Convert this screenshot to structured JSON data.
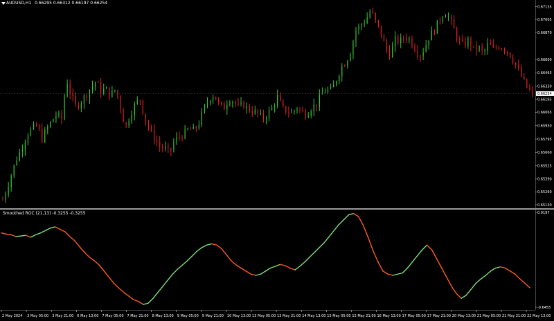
{
  "symbol_header": {
    "symbol": "AUDUSD,H1",
    "ohlc": "0.66295 0.66312 0.66197 0.66254"
  },
  "price_scale": {
    "ticks": [
      "0.67135",
      "0.67005",
      "0.66870",
      "0.66600",
      "0.66465",
      "0.66330",
      "0.66195",
      "0.66065",
      "0.65930",
      "0.65795",
      "0.65660",
      "0.65525",
      "0.65390",
      "0.65260",
      "0.65130"
    ],
    "current_price": "0.66254"
  },
  "indicator": {
    "title": "Smoothed ROC (21,13) -0.3255 -0.3255",
    "scale_top": "0.9197",
    "scale_bottom": "-0.6455"
  },
  "time_axis": {
    "labels": [
      "2 May 2024",
      "3 May 05:00",
      "3 May 21:00",
      "6 May 13:00",
      "7 May 05:00",
      "7 May 21:00",
      "8 May 13:00",
      "9 May 05:00",
      "9 May 21:00",
      "10 May 13:00",
      "13 May 05:00",
      "13 May 21:00",
      "14 May 13:00",
      "15 May 05:00",
      "15 May 21:00",
      "16 May 13:00",
      "17 May 05:00",
      "17 May 21:00",
      "20 May 13:00",
      "21 May 05:00",
      "21 May 21:00",
      "22 May 13:00"
    ]
  },
  "colors": {
    "background": "#000000",
    "bull_candle": "#32c832",
    "bear_candle": "#e02020",
    "roc_up": "#7ee07e",
    "roc_down": "#ff5a1f",
    "separator": "#9a9a9a"
  },
  "chart_data": [
    {
      "type": "candlestick",
      "title": "AUDUSD,H1",
      "ylim": [
        0.6513,
        0.6716
      ],
      "close_path": [
        0.6518,
        0.6532,
        0.6548,
        0.6562,
        0.6572,
        0.6585,
        0.659,
        0.6593,
        0.658,
        0.659,
        0.6598,
        0.6605,
        0.66,
        0.664,
        0.6622,
        0.6612,
        0.6618,
        0.6624,
        0.6632,
        0.6638,
        0.6628,
        0.663,
        0.6624,
        0.663,
        0.6612,
        0.659,
        0.6605,
        0.6615,
        0.662,
        0.66,
        0.6588,
        0.658,
        0.6572,
        0.657,
        0.6565,
        0.6578,
        0.6582,
        0.6585,
        0.659,
        0.6588,
        0.6596,
        0.661,
        0.662,
        0.6625,
        0.6615,
        0.661,
        0.662,
        0.6618,
        0.6612,
        0.6615,
        0.661,
        0.6608,
        0.6605,
        0.66,
        0.6605,
        0.6612,
        0.6622,
        0.661,
        0.6608,
        0.6606,
        0.6612,
        0.6606,
        0.6605,
        0.6612,
        0.6615,
        0.6625,
        0.663,
        0.6628,
        0.664,
        0.6652,
        0.6658,
        0.667,
        0.669,
        0.6695,
        0.67,
        0.671,
        0.6698,
        0.6688,
        0.6672,
        0.6665,
        0.668,
        0.6678,
        0.6684,
        0.668,
        0.6672,
        0.6664,
        0.6672,
        0.6684,
        0.669,
        0.67,
        0.6708,
        0.6702,
        0.669,
        0.6678,
        0.6674,
        0.668,
        0.667,
        0.6672,
        0.6666,
        0.6676,
        0.667,
        0.6674,
        0.6672,
        0.6668,
        0.666,
        0.665,
        0.664,
        0.663,
        0.6625
      ]
    },
    {
      "type": "line",
      "title": "Smoothed ROC (21,13)",
      "ylim": [
        -0.6455,
        0.9197
      ],
      "values": [
        0.58,
        0.56,
        0.55,
        0.52,
        0.53,
        0.54,
        0.51,
        0.55,
        0.58,
        0.62,
        0.66,
        0.68,
        0.64,
        0.6,
        0.52,
        0.45,
        0.35,
        0.26,
        0.18,
        0.12,
        0.05,
        -0.05,
        -0.15,
        -0.25,
        -0.33,
        -0.4,
        -0.46,
        -0.52,
        -0.55,
        -0.6,
        -0.58,
        -0.5,
        -0.4,
        -0.3,
        -0.2,
        -0.1,
        -0.02,
        0.05,
        0.12,
        0.2,
        0.28,
        0.34,
        0.38,
        0.4,
        0.38,
        0.32,
        0.22,
        0.12,
        0.05,
        0.0,
        -0.05,
        -0.1,
        -0.12,
        -0.1,
        -0.05,
        0.0,
        0.03,
        0.06,
        0.04,
        0.0,
        -0.03,
        0.03,
        0.1,
        0.18,
        0.26,
        0.34,
        0.42,
        0.52,
        0.62,
        0.72,
        0.8,
        0.88,
        0.9,
        0.85,
        0.7,
        0.5,
        0.28,
        0.1,
        -0.05,
        -0.1,
        -0.12,
        -0.1,
        -0.08,
        0.0,
        0.1,
        0.2,
        0.3,
        0.38,
        0.3,
        0.15,
        0.0,
        -0.15,
        -0.3,
        -0.42,
        -0.5,
        -0.45,
        -0.35,
        -0.25,
        -0.18,
        -0.12,
        -0.05,
        0.0,
        0.02,
        0.0,
        -0.05,
        -0.1,
        -0.18,
        -0.25,
        -0.3255
      ]
    }
  ]
}
